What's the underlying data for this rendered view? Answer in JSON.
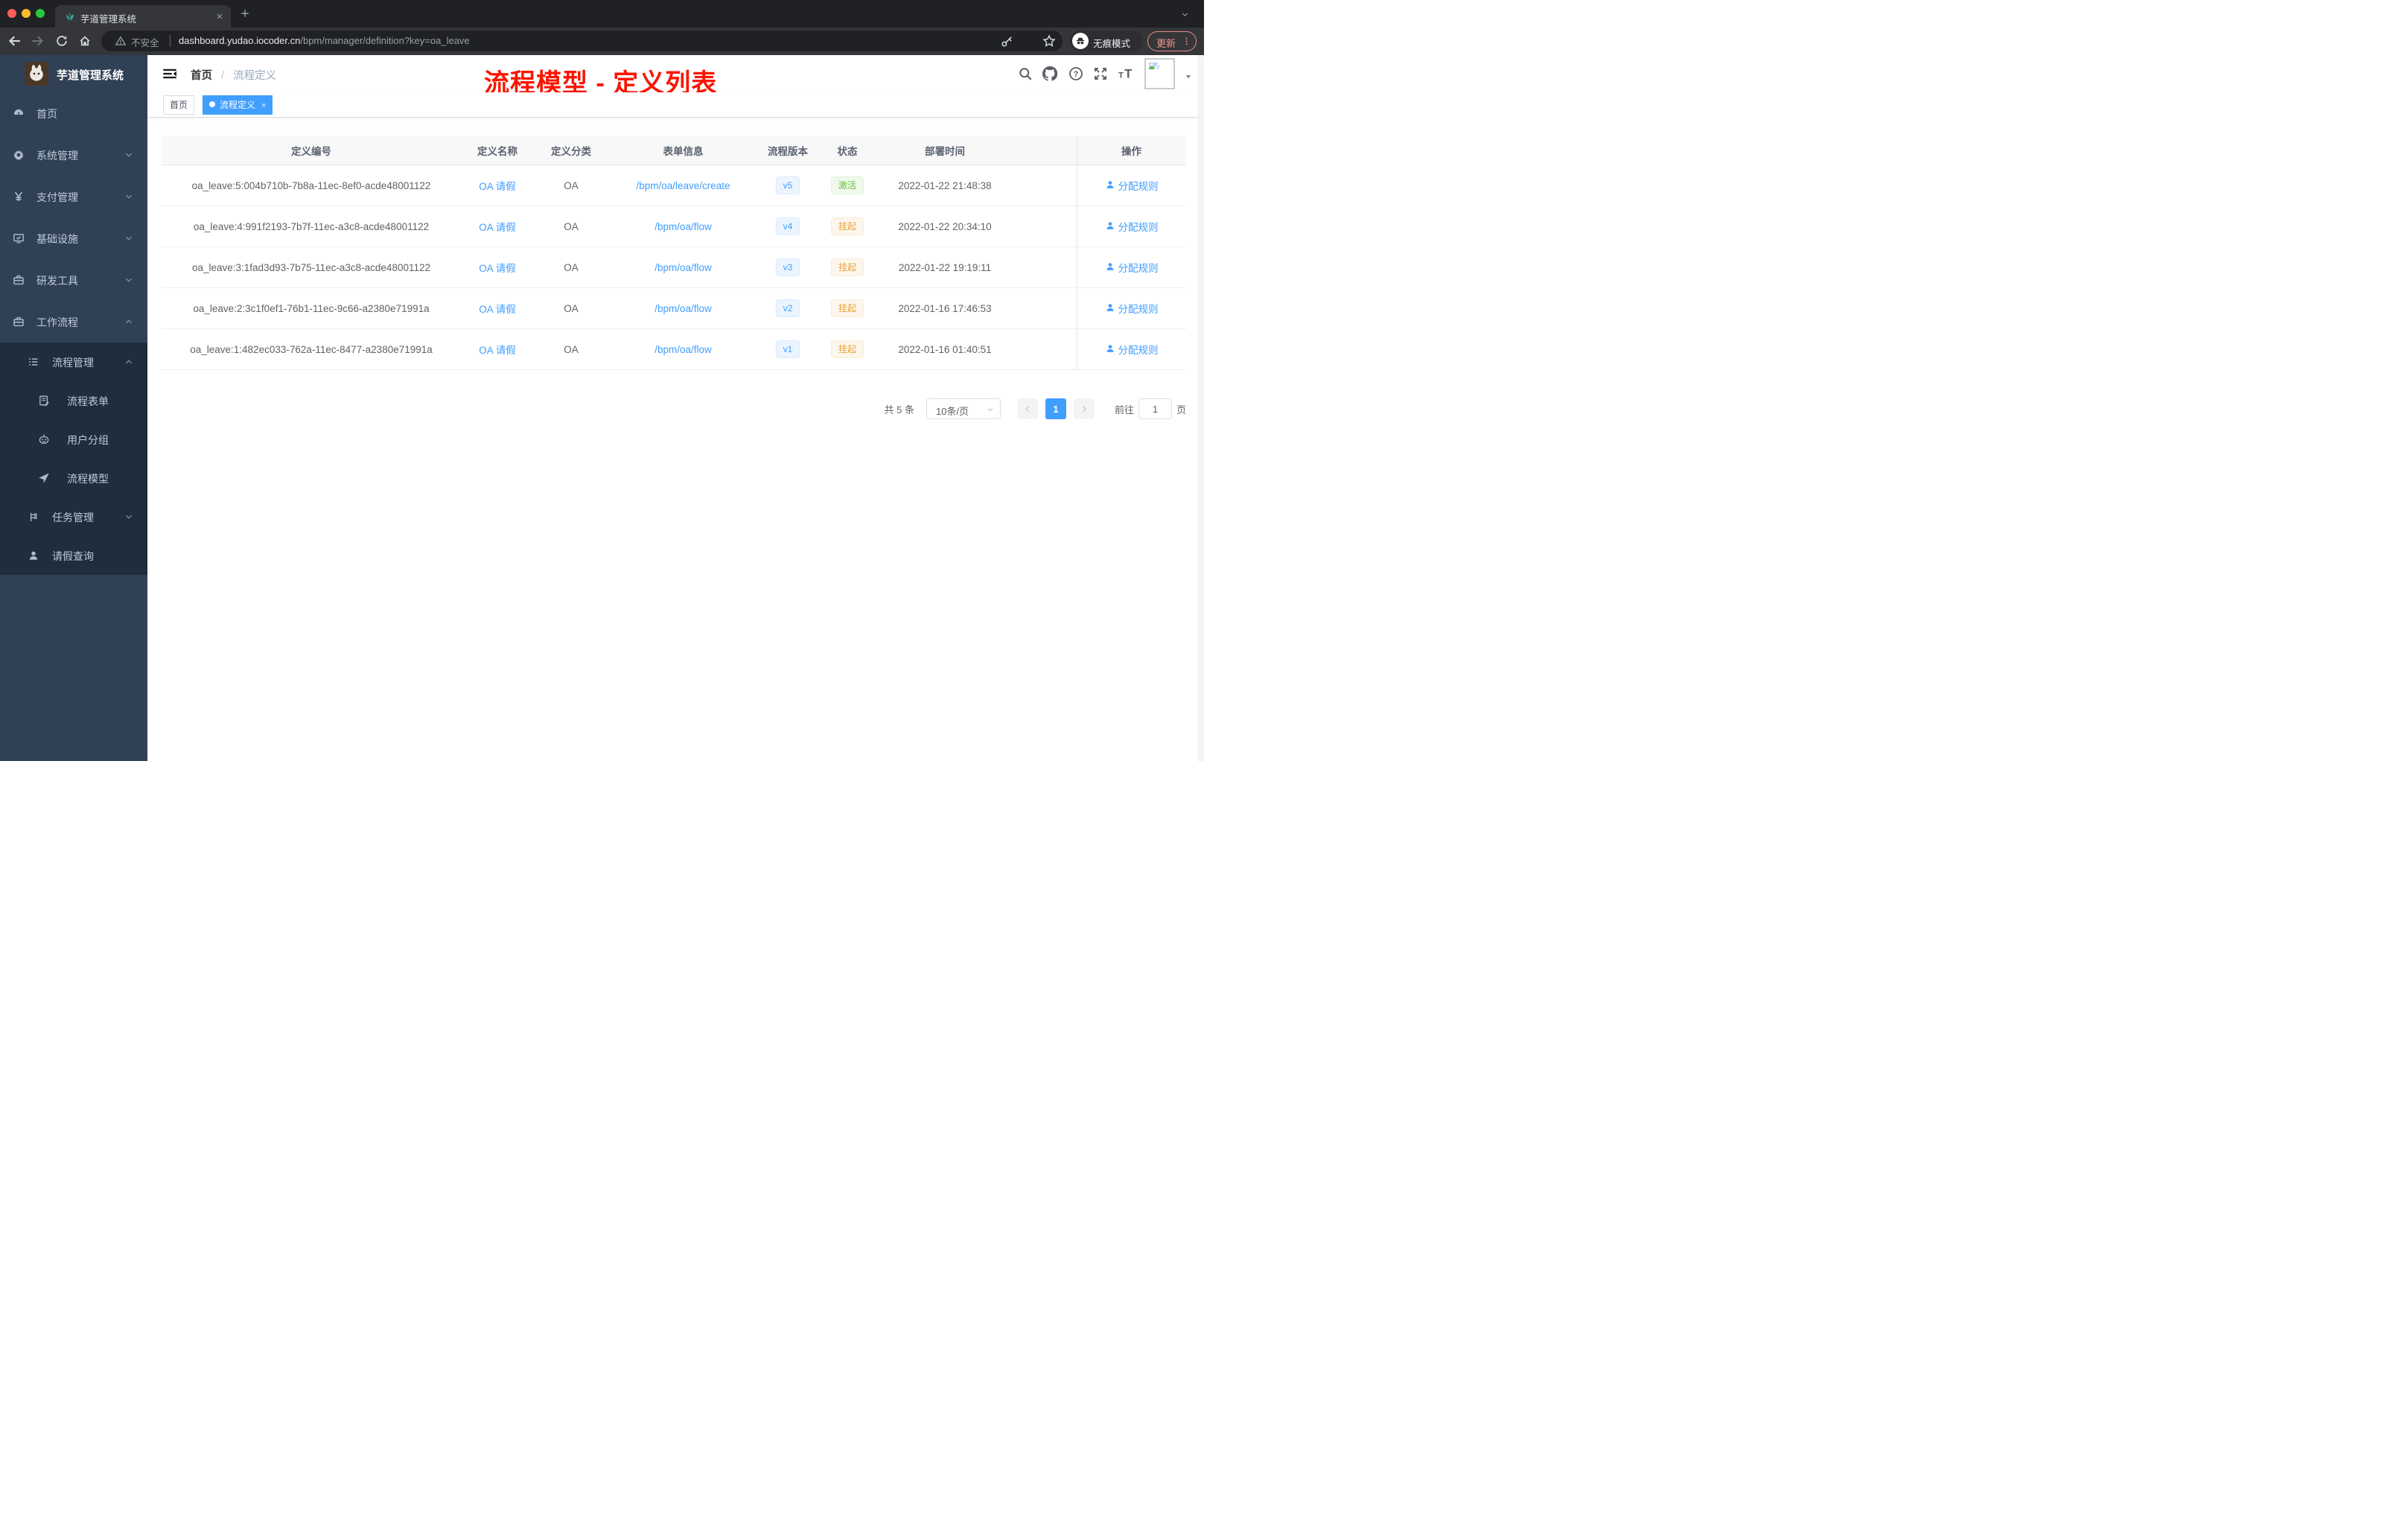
{
  "colors": {
    "accent": "#409eff",
    "annotation_red": "#fb1500",
    "sidebar_bg": "#304156",
    "submenu_bg": "#1f2d3d",
    "status_active_green": "#67c23a",
    "status_suspend_orange": "#e6a23c",
    "update_chip": "#f2948c"
  },
  "browser": {
    "tab": {
      "title": "芋道管理系统"
    },
    "address": {
      "security_label": "不安全",
      "url_domain": "dashboard.yudao.iocoder.cn",
      "url_path": "/bpm/manager/definition?key=oa_leave",
      "incognito_label": "无痕模式",
      "update_label": "更新"
    }
  },
  "sidebar": {
    "logo_title": "芋道管理系统",
    "top_items": [
      {
        "label": "首页",
        "icon": "dashboard-icon",
        "level": 1,
        "chevron": ""
      },
      {
        "label": "系统管理",
        "icon": "gear-icon",
        "level": 1,
        "chevron": "down"
      },
      {
        "label": "支付管理",
        "icon": "yen-icon",
        "level": 1,
        "chevron": "down"
      },
      {
        "label": "基础设施",
        "icon": "monitor-icon",
        "level": 1,
        "chevron": "down"
      },
      {
        "label": "研发工具",
        "icon": "toolbox-icon",
        "level": 1,
        "chevron": "down"
      },
      {
        "label": "工作流程",
        "icon": "briefcase-icon",
        "level": 1,
        "chevron": "up"
      }
    ],
    "sub_items": [
      {
        "label": "流程管理",
        "icon": "list-icon",
        "level": 2,
        "chevron": "up"
      },
      {
        "label": "流程表单",
        "icon": "form-icon",
        "level": 3,
        "chevron": ""
      },
      {
        "label": "用户分组",
        "icon": "robot-icon",
        "level": 3,
        "chevron": ""
      },
      {
        "label": "流程模型",
        "icon": "paper-plane-icon",
        "level": 3,
        "chevron": ""
      },
      {
        "label": "任务管理",
        "icon": "tree-icon",
        "level": 2,
        "chevron": "down"
      },
      {
        "label": "请假查询",
        "icon": "user-icon",
        "level": 2,
        "chevron": ""
      }
    ]
  },
  "header": {
    "breadcrumb": {
      "first": "首页",
      "separator": "/",
      "last": "流程定义"
    },
    "annotation": "流程模型 - 定义列表"
  },
  "tags_bar": {
    "tag_home": "首页",
    "tag_active": "流程定义",
    "close_glyph": "×"
  },
  "table": {
    "columns": [
      "定义编号",
      "定义名称",
      "定义分类",
      "表单信息",
      "流程版本",
      "状态",
      "部署时间",
      "操作"
    ],
    "action_label": "分配规则",
    "rows": [
      {
        "id": "oa_leave:5:004b710b-7b8a-11ec-8ef0-acde48001122",
        "name": "OA 请假",
        "category": "OA",
        "form": "/bpm/oa/leave/create",
        "version": "v5",
        "status": "激活",
        "status_type": "success",
        "deploy_time": "2022-01-22 21:48:38"
      },
      {
        "id": "oa_leave:4:991f2193-7b7f-11ec-a3c8-acde48001122",
        "name": "OA 请假",
        "category": "OA",
        "form": "/bpm/oa/flow",
        "version": "v4",
        "status": "挂起",
        "status_type": "warning",
        "deploy_time": "2022-01-22 20:34:10"
      },
      {
        "id": "oa_leave:3:1fad3d93-7b75-11ec-a3c8-acde48001122",
        "name": "OA 请假",
        "category": "OA",
        "form": "/bpm/oa/flow",
        "version": "v3",
        "status": "挂起",
        "status_type": "warning",
        "deploy_time": "2022-01-22 19:19:11"
      },
      {
        "id": "oa_leave:2:3c1f0ef1-76b1-11ec-9c66-a2380e71991a",
        "name": "OA 请假",
        "category": "OA",
        "form": "/bpm/oa/flow",
        "version": "v2",
        "status": "挂起",
        "status_type": "warning",
        "deploy_time": "2022-01-16 17:46:53"
      },
      {
        "id": "oa_leave:1:482ec033-762a-11ec-8477-a2380e71991a",
        "name": "OA 请假",
        "category": "OA",
        "form": "/bpm/oa/flow",
        "version": "v1",
        "status": "挂起",
        "status_type": "warning",
        "deploy_time": "2022-01-16 01:40:51"
      }
    ]
  },
  "pagination": {
    "total_label": "共 5 条",
    "page_size": "10条/页",
    "current_page": "1",
    "goto_label": "前往",
    "goto_value": "1",
    "page_unit": "页"
  }
}
